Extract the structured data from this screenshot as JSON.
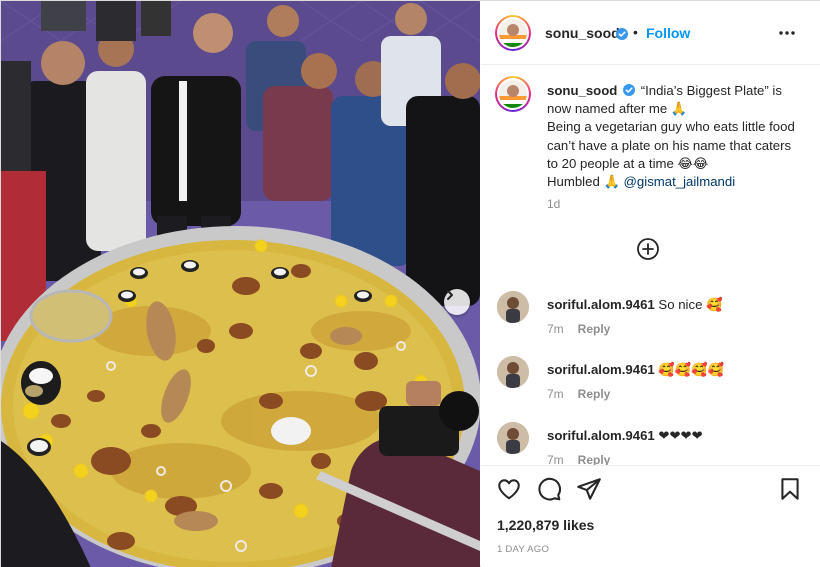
{
  "header": {
    "username": "sonu_sood",
    "separator": "•",
    "follow_label": "Follow"
  },
  "caption": {
    "username": "sonu_sood",
    "line1": "“India’s Biggest Plate” is now named after me 🙏",
    "line2": "Being a vegetarian guy who eats little food can’t have a plate on his name that caters to 20 people at a time 😂😂",
    "line3": "Humbled 🙏",
    "mention": "@gismat_jailmandi",
    "age": "1d"
  },
  "comments": [
    {
      "username": "soriful.alom.9461",
      "text": "So nice 🥰",
      "age": "7m",
      "reply": "Reply"
    },
    {
      "username": "soriful.alom.9461",
      "text": "🥰🥰🥰🥰",
      "age": "7m",
      "reply": "Reply"
    },
    {
      "username": "soriful.alom.9461",
      "text": "❤❤❤❤",
      "age": "7m",
      "reply": "Reply"
    }
  ],
  "footer": {
    "likes": "1,220,879 likes",
    "posted": "1 DAY AGO"
  },
  "icons": {
    "verified": "verified-badge-icon",
    "more": "more-options-icon",
    "load_more": "load-more-comments-icon",
    "like": "heart-icon",
    "comment": "comment-icon",
    "share": "share-icon",
    "save": "bookmark-icon",
    "next": "chevron-right-icon"
  },
  "colors": {
    "follow": "#0095f6",
    "verified": "#3897f0",
    "mention": "#00376b",
    "muted": "#8e8e8e"
  }
}
